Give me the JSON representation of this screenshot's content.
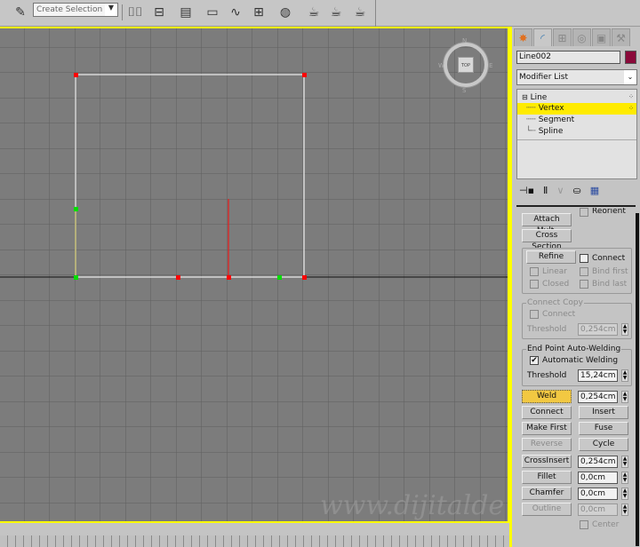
{
  "toolbar": {
    "selection_set_placeholder": "Create Selection Se",
    "icons": [
      "edit-named-selection-icon",
      "mirror-icon",
      "align-icon",
      "layer-manager-icon",
      "scene-explorer-icon",
      "curve-editor-icon",
      "schematic-view-icon",
      "material-editor-icon",
      "render-setup-icon",
      "render-frame-icon",
      "render-icon"
    ]
  },
  "viewport": {
    "label_viewcube": "TOP",
    "compass": {
      "n": "N",
      "s": "S",
      "e": "E",
      "w": "W"
    },
    "watermark": "www.dijitalde",
    "border_color": "#ffff00",
    "vertex_selected_color": "#ff0000",
    "vertex_first_color": "#00dd00"
  },
  "panel": {
    "tabs": [
      "create",
      "modify",
      "hierarchy",
      "motion",
      "display",
      "utilities"
    ],
    "object_name": "Line002",
    "object_color": "#8a0a3a",
    "modifier_list": "Modifier List",
    "stack": [
      {
        "label": "Line",
        "level": 0
      },
      {
        "label": "Vertex",
        "level": 1,
        "selected": true
      },
      {
        "label": "Segment",
        "level": 1
      },
      {
        "label": "Spline",
        "level": 1
      }
    ],
    "stack_tools": [
      "pin-stack-icon",
      "show-end-result-icon",
      "make-unique-icon",
      "remove-modifier-icon",
      "configure-sets-icon"
    ],
    "geometry": {
      "attach_mult": "Attach Mult.",
      "reorient": "Reorient",
      "cross_section": "Cross Section",
      "refine": "Refine",
      "connect": "Connect",
      "linear": "Linear",
      "bind_first": "Bind first",
      "closed": "Closed",
      "bind_last": "Bind last",
      "connect_copy_title": "Connect Copy",
      "connect_copy_connect": "Connect",
      "threshold_label": "Threshold",
      "connect_copy_threshold": "0,254cm",
      "end_point_title": "End Point Auto-Welding",
      "automatic_welding": "Automatic Welding",
      "automatic_welding_checked": true,
      "weld_threshold": "15,24cm",
      "weld": "Weld",
      "weld_value": "0,254cm",
      "connect_btn": "Connect",
      "insert": "Insert",
      "make_first": "Make First",
      "fuse": "Fuse",
      "reverse": "Reverse",
      "cycle": "Cycle",
      "cross_insert": "CrossInsert",
      "cross_insert_value": "0,254cm",
      "fillet": "Fillet",
      "fillet_value": "0,0cm",
      "chamfer": "Chamfer",
      "chamfer_value": "0,0cm",
      "outline": "Outline",
      "outline_value": "0,0cm",
      "center": "Center"
    }
  }
}
